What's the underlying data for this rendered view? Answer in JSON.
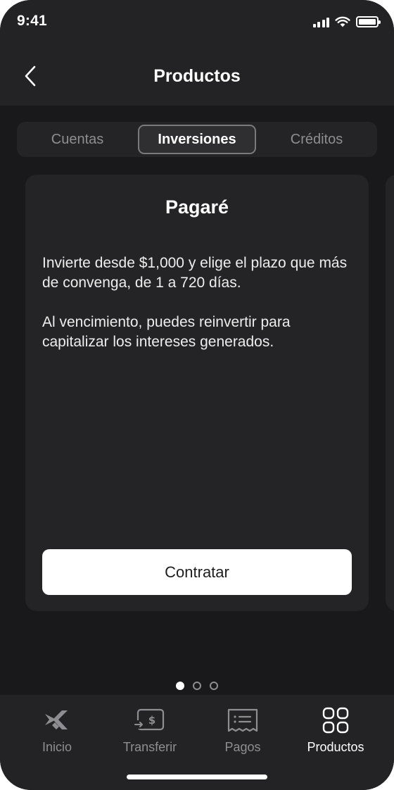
{
  "status_bar": {
    "time": "9:41"
  },
  "header": {
    "title": "Productos"
  },
  "tabs": [
    {
      "label": "Cuentas",
      "active": false
    },
    {
      "label": "Inversiones",
      "active": true
    },
    {
      "label": "Créditos",
      "active": false
    }
  ],
  "card": {
    "title": "Pagaré",
    "paragraph_1": "Invierte desde $1,000 y elige el plazo que más de convenga, de 1 a 720 días.",
    "paragraph_2": "Al vencimiento, puedes reinvertir para capitalizar los intereses generados.",
    "cta_label": "Contratar"
  },
  "pager": {
    "pages": 3,
    "current": 1
  },
  "bottom_nav": [
    {
      "label": "Inicio",
      "icon": "home-logo-icon",
      "active": false
    },
    {
      "label": "Transferir",
      "icon": "transfer-icon",
      "active": false
    },
    {
      "label": "Pagos",
      "icon": "payments-list-icon",
      "active": false
    },
    {
      "label": "Productos",
      "icon": "products-grid-icon",
      "active": true
    }
  ],
  "colors": {
    "background": "#19191b",
    "surface": "#242426",
    "accent": "#ffffff",
    "muted": "#8e8e92"
  }
}
